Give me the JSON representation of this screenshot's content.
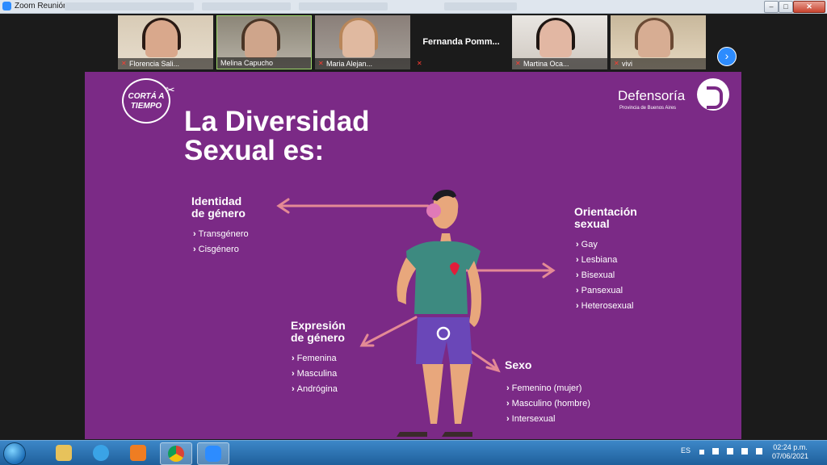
{
  "window": {
    "title": "Zoom Reunión",
    "buttons": [
      "–",
      "□",
      "✕"
    ]
  },
  "gallery": {
    "participants": [
      {
        "name": "Florencia Sali...",
        "muted": true,
        "video": true
      },
      {
        "name": "Melina Capucho",
        "muted": false,
        "video": true
      },
      {
        "name": "Maria Alejan...",
        "muted": true,
        "video": true
      },
      {
        "name": "Fernanda  Pomm...",
        "muted": true,
        "video": false
      },
      {
        "name": "Martina Oca...",
        "muted": true,
        "video": true
      },
      {
        "name": "vivi",
        "muted": true,
        "video": true
      }
    ],
    "next_icon": "chevron-right-icon"
  },
  "slide": {
    "logo_text": "CORTÁ A TIEMPO",
    "title_line1": "La Diversidad",
    "title_line2": "Sexual es:",
    "org_name": "Defensoría",
    "org_sub": "Provincia de Buenos Aires",
    "identidad": {
      "heading1": "Identidad",
      "heading2": "de género",
      "items": [
        "Transgénero",
        "Cisgénero"
      ]
    },
    "orientacion": {
      "heading1": "Orientación",
      "heading2": "sexual",
      "items": [
        "Gay",
        "Lesbiana",
        "Bisexual",
        "Pansexual",
        "Heterosexual"
      ]
    },
    "expresion": {
      "heading1": "Expresión",
      "heading2": "de género",
      "items": [
        "Femenina",
        "Masculina",
        "Andrógina"
      ]
    },
    "sexo": {
      "heading": "Sexo",
      "items": [
        "Femenino (mujer)",
        "Masculino (hombre)",
        "Intersexual"
      ]
    },
    "colors": {
      "background": "#7b2a86",
      "arrow": "#e48a95",
      "text": "#ffffff"
    }
  },
  "taskbar": {
    "apps": [
      "file-explorer-icon",
      "internet-explorer-icon",
      "media-player-icon",
      "chrome-icon",
      "zoom-icon"
    ],
    "language": "ES",
    "time": "02:24 p.m.",
    "date": "07/06/2021"
  }
}
